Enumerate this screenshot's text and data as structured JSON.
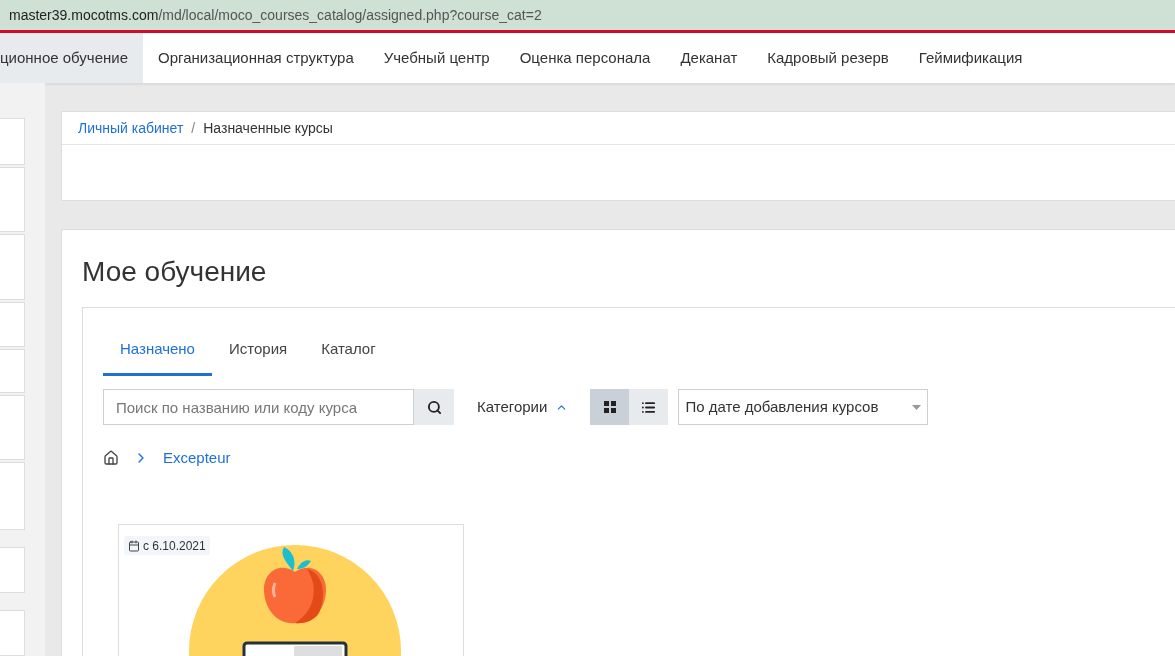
{
  "address_bar": {
    "host": "master39.mocotms.com",
    "path": "/md/local/moco_courses_catalog/assigned.php?course_cat=2"
  },
  "nav": [
    {
      "label": "ционное обучение",
      "selected": true
    },
    {
      "label": "Организационная структура",
      "selected": false
    },
    {
      "label": "Учебный центр",
      "selected": false
    },
    {
      "label": "Оценка персонала",
      "selected": false
    },
    {
      "label": "Деканат",
      "selected": false
    },
    {
      "label": "Кадровый резерв",
      "selected": false
    },
    {
      "label": "Геймификация",
      "selected": false
    }
  ],
  "breadcrumb": [
    {
      "label": "Личный кабинет",
      "kind": "link"
    },
    {
      "label": "/",
      "kind": "separator"
    },
    {
      "label": "Назначенные курсы",
      "kind": "current"
    }
  ],
  "page_title": "Мое обучение",
  "tabs": [
    {
      "label": "Назначено",
      "selected": true
    },
    {
      "label": "История",
      "selected": false
    },
    {
      "label": "Каталог",
      "selected": false
    }
  ],
  "search": {
    "placeholder": "Поиск по названию или коду курса"
  },
  "categories": {
    "label": "Категории",
    "expanded": true
  },
  "view_modes": [
    {
      "kind": "grid",
      "selected": true
    },
    {
      "kind": "list",
      "selected": false
    }
  ],
  "sort": {
    "value": "По дате добавления курсов"
  },
  "category_path": [
    "Excepteur"
  ],
  "courses": [
    {
      "date": "с 6.10.2021",
      "kind": "picture"
    }
  ]
}
